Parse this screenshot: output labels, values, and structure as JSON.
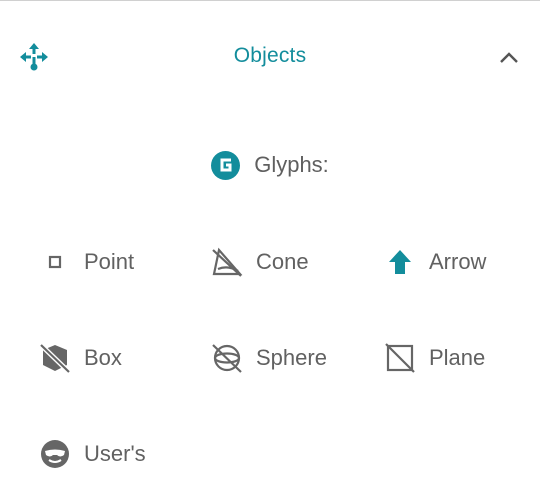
{
  "panel": {
    "title": "Objects",
    "header_icon": "move-arrows-icon",
    "collapse_icon": "chevron-up-icon",
    "accent_color": "#138d9c"
  },
  "glyphs": {
    "label": "Glyphs:",
    "badge_letter": "G",
    "items": [
      {
        "label": "Point",
        "icon": "point-icon"
      },
      {
        "label": "Cone",
        "icon": "cone-icon"
      },
      {
        "label": "Arrow",
        "icon": "arrow-icon"
      },
      {
        "label": "Box",
        "icon": "box-icon"
      },
      {
        "label": "Sphere",
        "icon": "sphere-icon"
      },
      {
        "label": "Plane",
        "icon": "plane-icon"
      },
      {
        "label": "User's",
        "icon": "user-glyph-icon"
      }
    ]
  }
}
